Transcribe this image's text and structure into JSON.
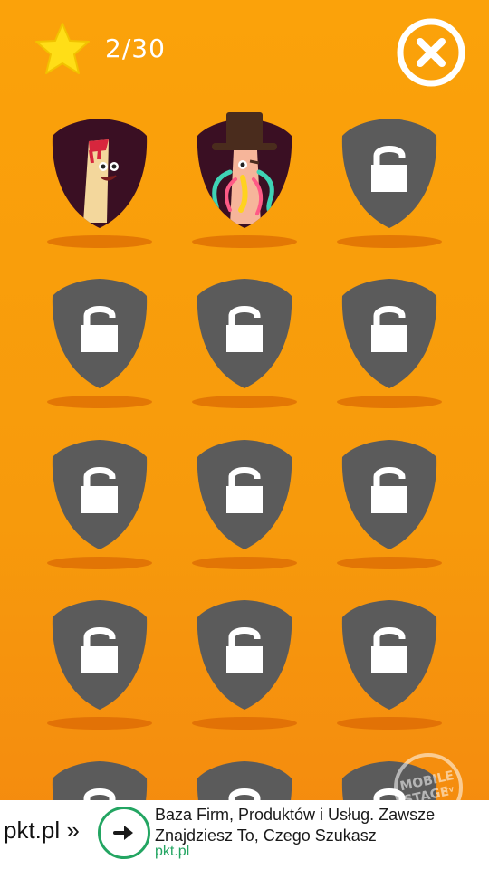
{
  "header": {
    "star_icon": "star-icon",
    "progress": "2/30",
    "close_icon": "close-icon"
  },
  "colors": {
    "background": "#fba20a",
    "locked_shield": "#5b5b5b",
    "unlocked_shield": "#3a0f23",
    "ad_accent": "#23a562"
  },
  "badges": [
    {
      "state": "unlocked",
      "character": "finger"
    },
    {
      "state": "unlocked",
      "character": "top-hat-tentacles"
    },
    {
      "state": "locked"
    },
    {
      "state": "locked"
    },
    {
      "state": "locked"
    },
    {
      "state": "locked"
    },
    {
      "state": "locked"
    },
    {
      "state": "locked"
    },
    {
      "state": "locked"
    },
    {
      "state": "locked"
    },
    {
      "state": "locked"
    },
    {
      "state": "locked"
    },
    {
      "state": "locked"
    },
    {
      "state": "locked"
    },
    {
      "state": "locked"
    }
  ],
  "ad": {
    "brand": "pkt.pl »",
    "headline_line1": "Baza Firm, Produktów i Usług. Zawsze",
    "headline_line2": "Znajdziesz To, Czego Szukasz",
    "url": "pkt.pl"
  },
  "watermark": {
    "line1": "MOBILE",
    "line2": "STAGE",
    "suffix": "TV"
  }
}
